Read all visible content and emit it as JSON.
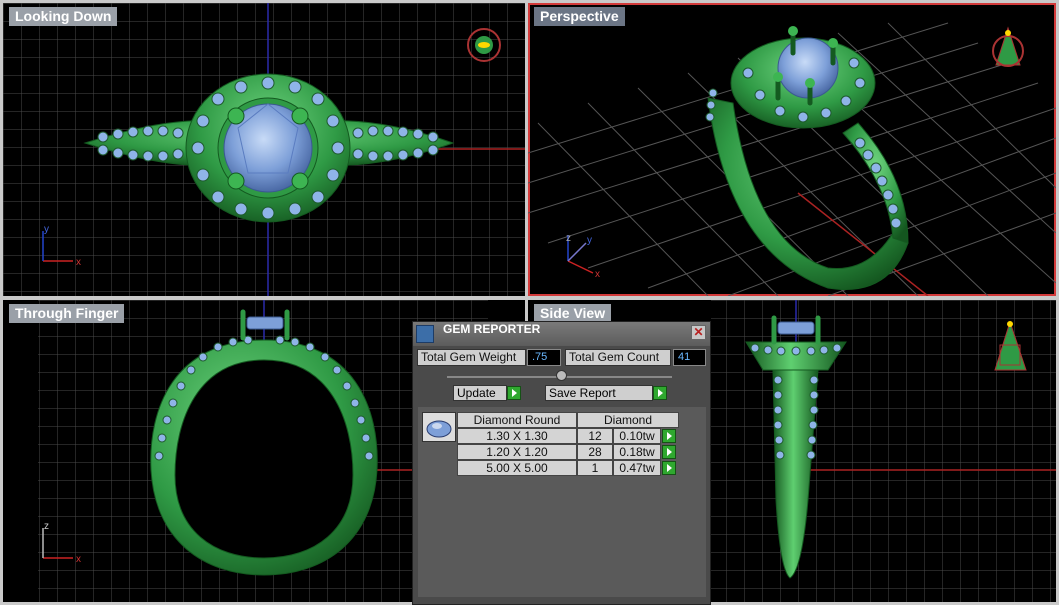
{
  "viewports": {
    "looking_down": {
      "title": "Looking Down",
      "axis_x": "x",
      "axis_y": "y"
    },
    "perspective": {
      "title": "Perspective",
      "axis_x": "x",
      "axis_y": "y",
      "axis_z": "z"
    },
    "through_finger": {
      "title": "Through Finger",
      "axis_x": "x",
      "axis_z": "z"
    },
    "side_view": {
      "title": "Side View"
    }
  },
  "gem_reporter": {
    "title": "GEM REPORTER",
    "close_label": "✕",
    "total_weight_label": "Total Gem Weight",
    "total_weight_value": ".75",
    "total_count_label": "Total Gem Count",
    "total_count_value": "41",
    "update_label": "Update",
    "save_report_label": "Save Report",
    "table": {
      "header_shape": "Diamond Round",
      "header_type": "Diamond",
      "rows": [
        {
          "size": "1.30 X 1.30",
          "count": "12",
          "weight": "0.10tw"
        },
        {
          "size": "1.20 X 1.20",
          "count": "28",
          "weight": "0.18tw"
        },
        {
          "size": "5.00 X 5.00",
          "count": "1",
          "weight": "0.47tw"
        }
      ]
    }
  },
  "colors": {
    "metal": "#2f9a45",
    "gem": "#8fb4e8",
    "grid": "#5a5a5a",
    "active_border": "#d23a3a"
  }
}
